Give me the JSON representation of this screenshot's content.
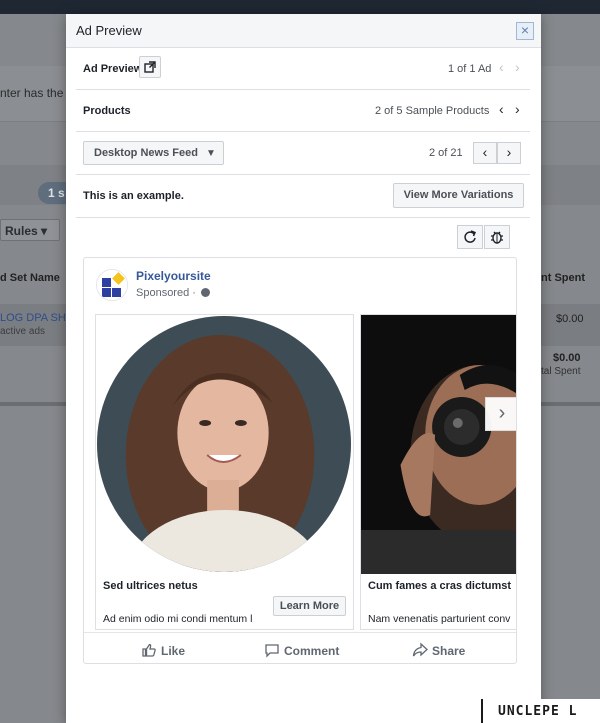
{
  "background": {
    "notice_text": "nter has the m",
    "pill_text": "1 s",
    "rules_label": "Rules",
    "col_left": "d Set Name",
    "row_link": "LOG DPA SHO",
    "row_sub": "active ads",
    "col_right": "nt Spent",
    "amount_row": "$0.00",
    "amount_total": "$0.00",
    "amount_total_label": "tal Spent"
  },
  "modal": {
    "title": "Ad Preview",
    "close_glyph": "×",
    "ad_preview_label": "Ad Preview",
    "ad_count": "1 of 1 Ad",
    "products_label": "Products",
    "products_count": "2 of 5 Sample Products",
    "placement": "Desktop News Feed",
    "placement_count": "2 of 21",
    "example_text": "This is an example.",
    "view_more_label": "View More Variations",
    "icons": [
      "external-link-icon",
      "refresh-icon",
      "bug-icon",
      "chevron-left-icon",
      "chevron-right-icon",
      "dropdown-caret-icon"
    ]
  },
  "ad": {
    "page_name": "Pixelyoursite",
    "sponsored": "Sponsored ·",
    "cards": [
      {
        "title": "Sed ultrices netus",
        "description": "Ad enim odio mi condi mentum l",
        "cta": "Learn More"
      },
      {
        "title": "Cum fames a cras dictumst",
        "description": "Nam venenatis parturient conv"
      }
    ],
    "actions": {
      "like": "Like",
      "comment": "Comment",
      "share": "Share"
    },
    "colors": {
      "link": "#365899",
      "logo_blue": "#2d3fa0",
      "logo_yellow": "#f5c31c"
    }
  },
  "watermark": "UNCLEPE L"
}
